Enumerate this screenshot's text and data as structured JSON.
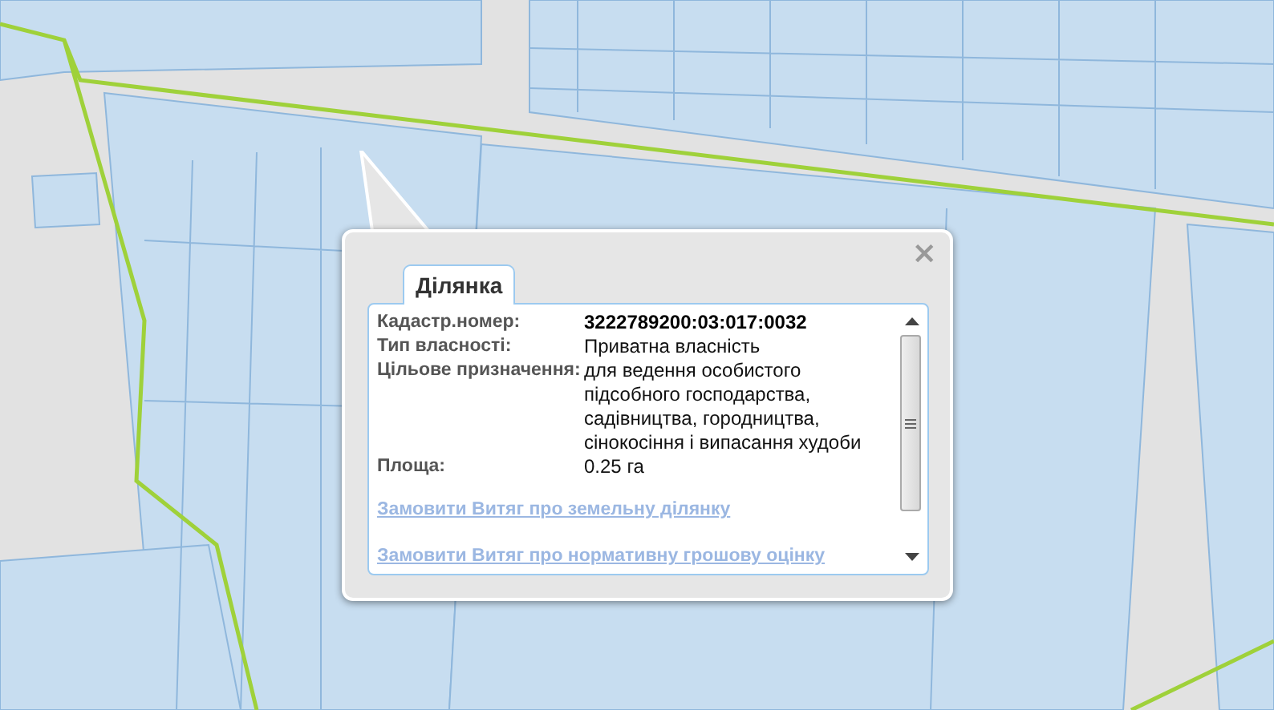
{
  "popup": {
    "close": "×",
    "tab": {
      "label": "Ділянка",
      "selected": true
    },
    "fields": [
      {
        "label": "Кадастр.номер:",
        "value": "3222789200:03:017:0032",
        "kind": "key"
      },
      {
        "label": "Тип власності:",
        "value": "Приватна власність",
        "kind": "plain"
      },
      {
        "label": "Цільове призначення:",
        "value": "для ведення особистого підсобного господарства, садівництва, городництва, сінокосіння і випасання худоби",
        "kind": "plain"
      },
      {
        "label": "Площа:",
        "value": "0.25 га",
        "kind": "plain"
      }
    ],
    "links": [
      "Замовити Витяг про земельну ділянку",
      "Замовити Витяг про нормативну грошову оцінку"
    ]
  }
}
